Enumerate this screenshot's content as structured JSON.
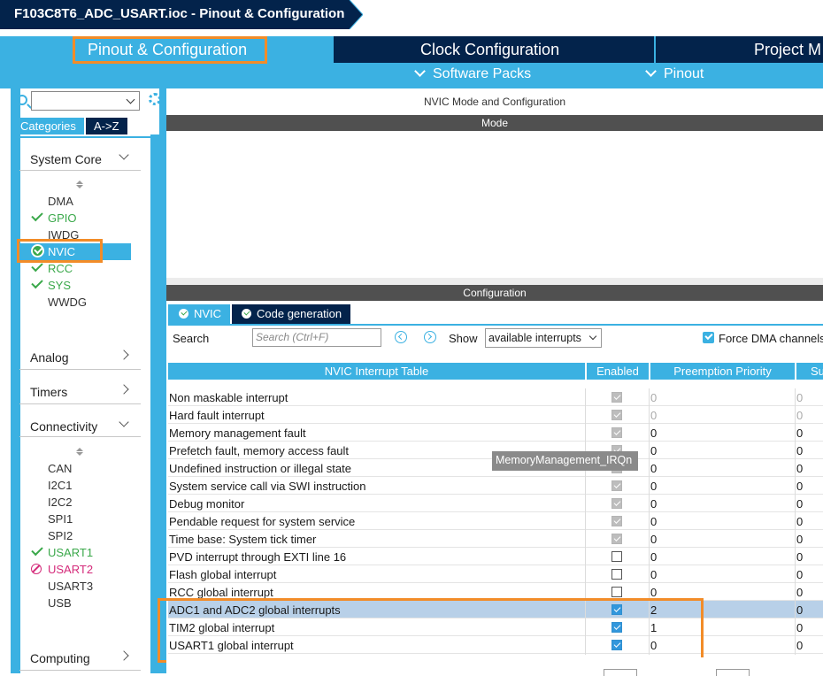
{
  "window": {
    "title": "F103C8T6_ADC_USART.ioc - Pinout & Configuration"
  },
  "tabs": {
    "pinout": "Pinout & Configuration",
    "clock": "Clock Configuration",
    "project": "Project M",
    "software_packs": "Software Packs",
    "pinout_menu": "Pinout"
  },
  "sidebar": {
    "search_value": "",
    "categories_tab": "Categories",
    "az_tab": "A->Z",
    "system_core": {
      "label": "System Core",
      "items": [
        "DMA",
        "GPIO",
        "IWDG",
        "NVIC",
        "RCC",
        "SYS",
        "WWDG"
      ]
    },
    "analog": "Analog",
    "timers": "Timers",
    "connectivity": {
      "label": "Connectivity",
      "items": [
        "CAN",
        "I2C1",
        "I2C2",
        "SPI1",
        "SPI2",
        "USART1",
        "USART2",
        "USART3",
        "USB"
      ]
    },
    "computing": "Computing"
  },
  "main": {
    "title": "NVIC Mode and Configuration",
    "mode_header": "Mode",
    "config_header": "Configuration",
    "tabs": [
      "NVIC",
      "Code generation"
    ],
    "search_label": "Search",
    "search_placeholder": "Search (Ctrl+F)",
    "show_label": "Show",
    "show_value": "available interrupts",
    "force_dma_label": "Force DMA channels",
    "tooltip": "MemoryManagement_IRQn"
  },
  "table": {
    "headers": [
      "NVIC Interrupt Table",
      "Enabled",
      "Preemption Priority",
      "Su"
    ],
    "rows": [
      {
        "name": "Non maskable interrupt",
        "enabled": "locked",
        "pre": "0",
        "sub": "0",
        "grey": true
      },
      {
        "name": "Hard fault interrupt",
        "enabled": "locked",
        "pre": "0",
        "sub": "0",
        "grey": true
      },
      {
        "name": "Memory management fault",
        "enabled": "locked",
        "pre": "0",
        "sub": "0",
        "grey": false
      },
      {
        "name": "Prefetch fault, memory access fault",
        "enabled": "locked",
        "pre": "0",
        "sub": "0",
        "grey": false
      },
      {
        "name": "Undefined instruction or illegal state",
        "enabled": "locked",
        "pre": "0",
        "sub": "0",
        "grey": false
      },
      {
        "name": "System service call via SWI instruction",
        "enabled": "locked",
        "pre": "0",
        "sub": "0",
        "grey": false
      },
      {
        "name": "Debug monitor",
        "enabled": "locked",
        "pre": "0",
        "sub": "0",
        "grey": false
      },
      {
        "name": "Pendable request for system service",
        "enabled": "locked",
        "pre": "0",
        "sub": "0",
        "grey": false
      },
      {
        "name": "Time base: System tick timer",
        "enabled": "locked",
        "pre": "0",
        "sub": "0",
        "grey": false
      },
      {
        "name": "PVD interrupt through EXTI line 16",
        "enabled": "off",
        "pre": "0",
        "sub": "0",
        "grey": false
      },
      {
        "name": "Flash global interrupt",
        "enabled": "off",
        "pre": "0",
        "sub": "0",
        "grey": false
      },
      {
        "name": "RCC global interrupt",
        "enabled": "off",
        "pre": "0",
        "sub": "0",
        "grey": false
      },
      {
        "name": "ADC1 and ADC2 global interrupts",
        "enabled": "on",
        "pre": "2",
        "sub": "0",
        "grey": false
      },
      {
        "name": "TIM2 global interrupt",
        "enabled": "on",
        "pre": "1",
        "sub": "0",
        "grey": false
      },
      {
        "name": "USART1 global interrupt",
        "enabled": "on",
        "pre": "0",
        "sub": "0",
        "grey": false
      }
    ]
  },
  "colors": {
    "accent": "#3bb1e2",
    "navy": "#03234b",
    "highlight": "#f28c28",
    "ok": "#3aa84a",
    "error": "#d42a7a"
  }
}
